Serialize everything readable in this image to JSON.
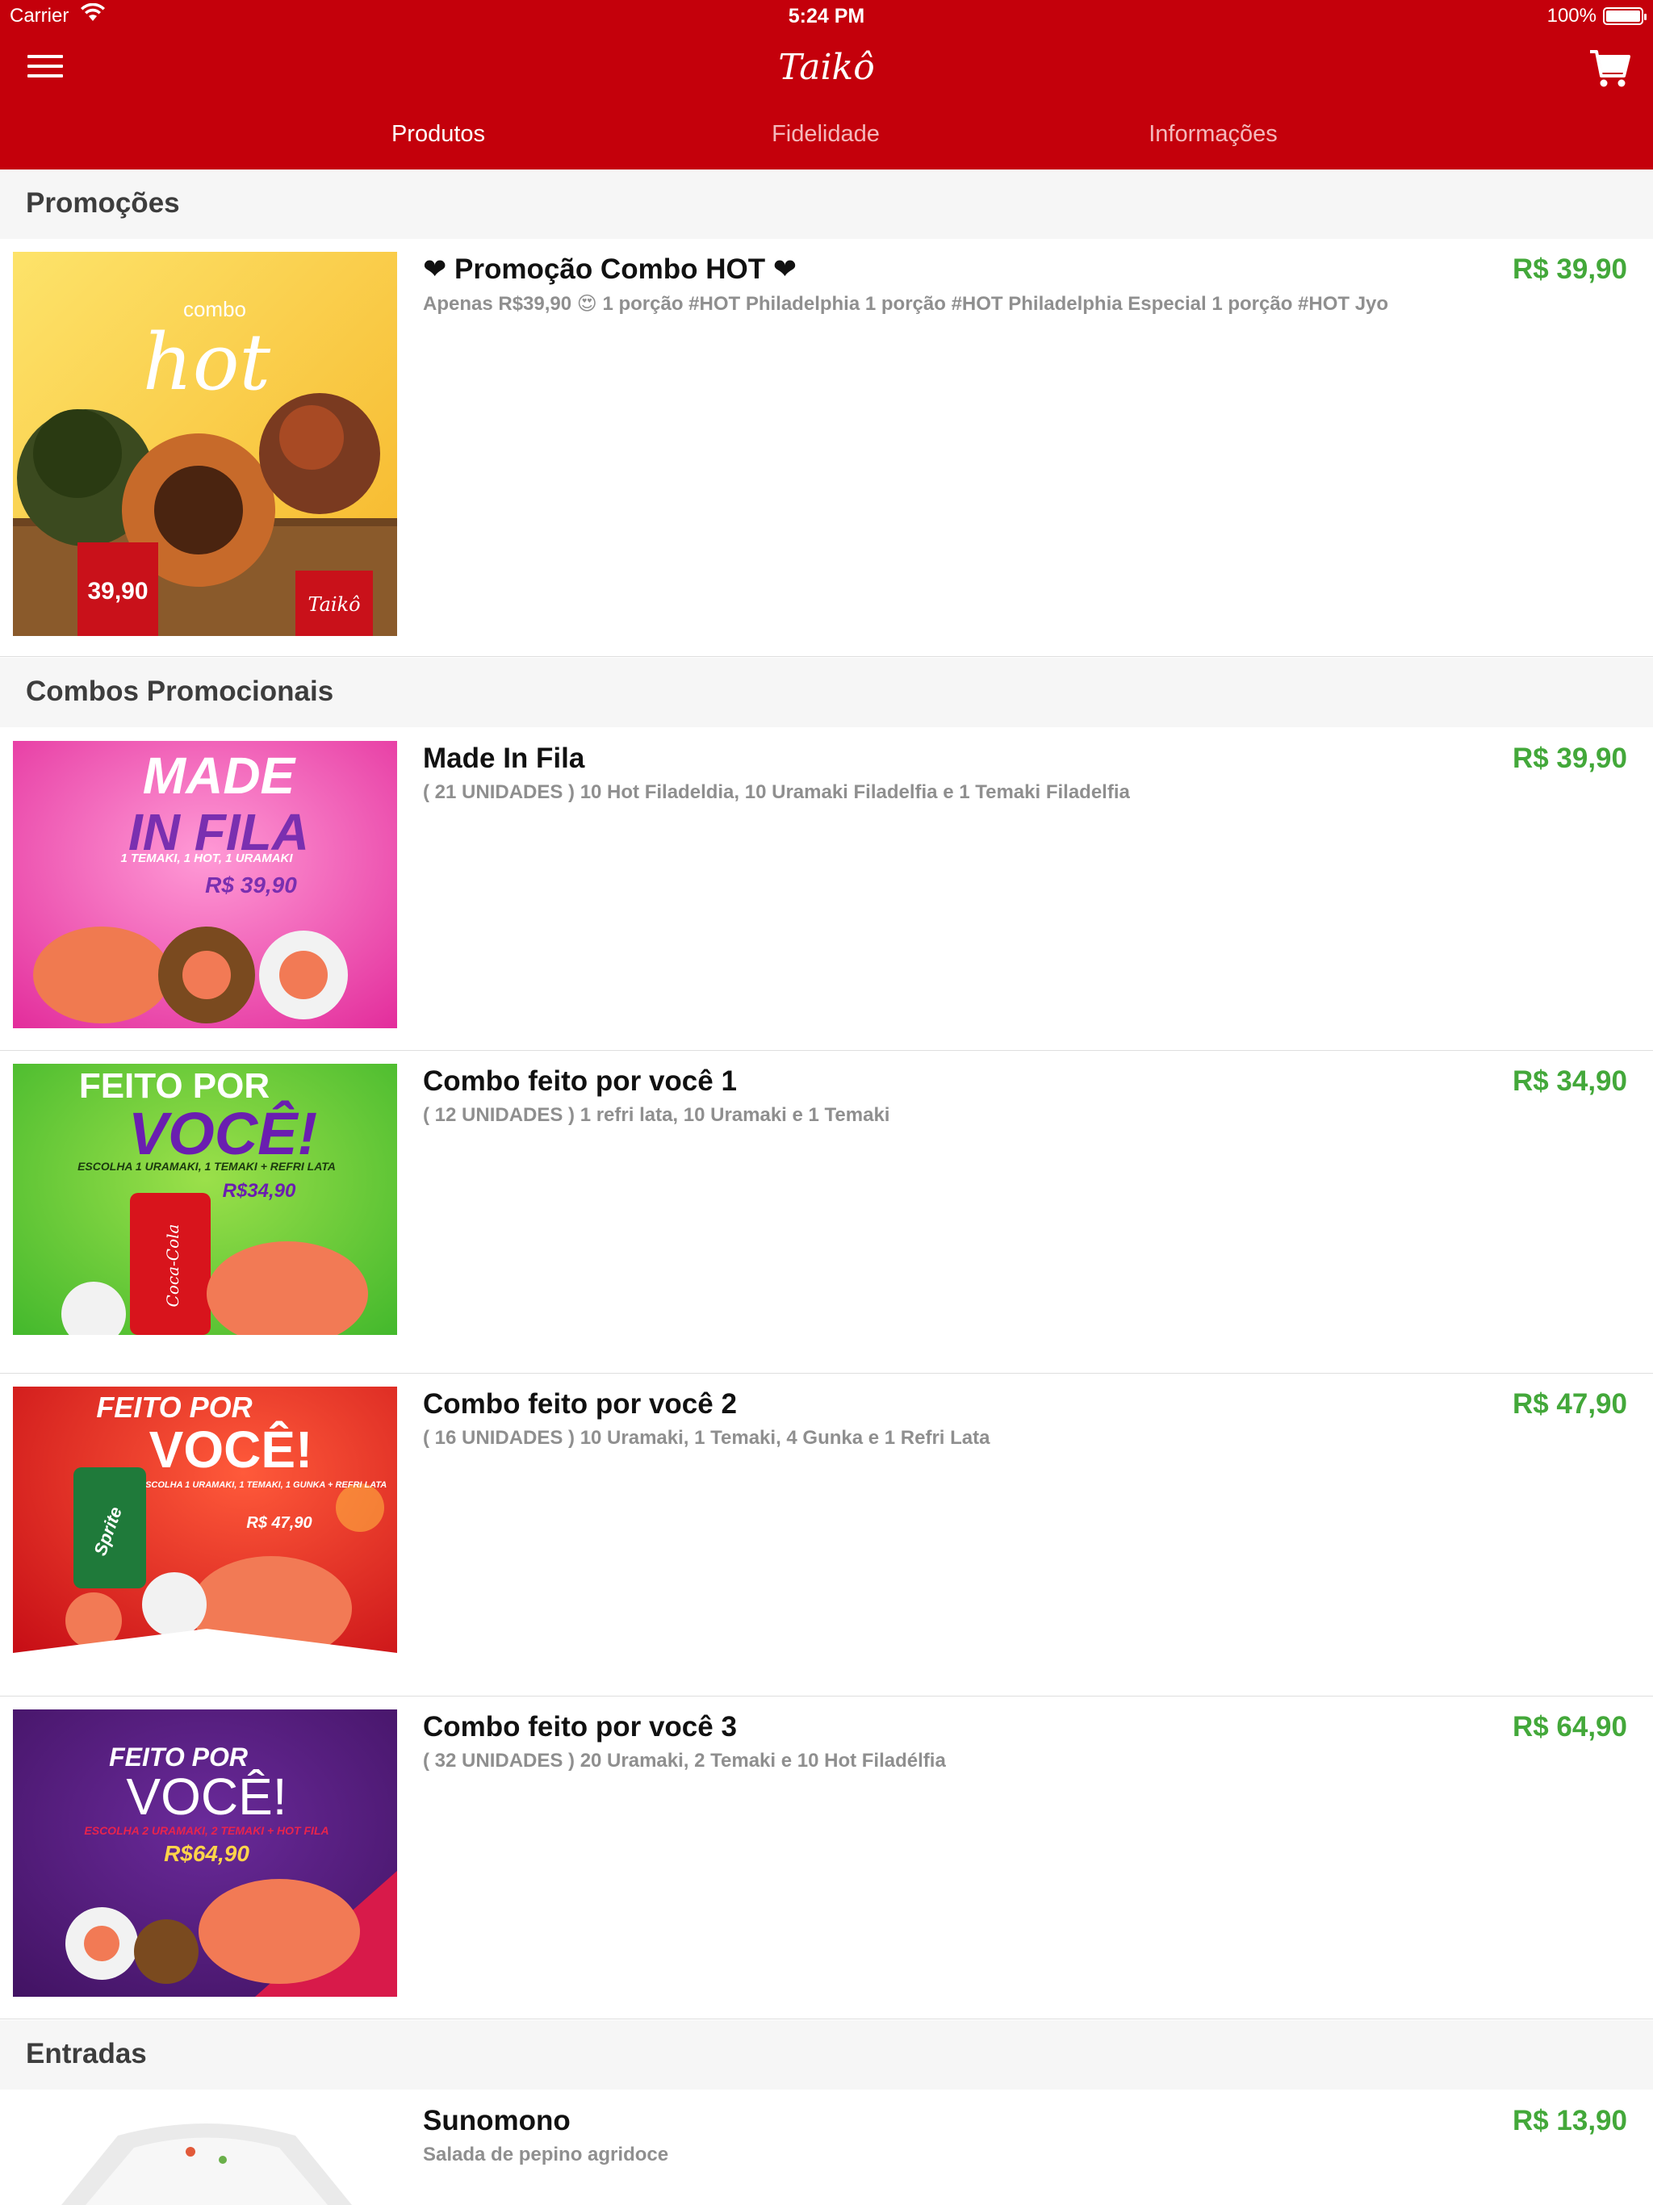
{
  "status_bar": {
    "carrier": "Carrier",
    "time": "5:24 PM",
    "battery": "100%"
  },
  "header": {
    "logo_text": "Taikô",
    "brand_color": "#c4000b"
  },
  "tabs": [
    {
      "label": "Produtos",
      "active": true
    },
    {
      "label": "Fidelidade",
      "active": false
    },
    {
      "label": "Informações",
      "active": false
    }
  ],
  "sections": [
    {
      "title": "Promoções",
      "items": [
        {
          "title": "❤ Promoção Combo HOT ❤",
          "description": "Apenas R$39,90 😍 1 porção #HOT Philadelphia 1 porção #HOT Philadelphia Especial 1 porção #HOT Jyo",
          "price": "R$ 39,90",
          "image_text": {
            "line1": "combo",
            "line2": "hot",
            "price": "39,90",
            "brand": "Taikô"
          }
        }
      ]
    },
    {
      "title": "Combos Promocionais",
      "items": [
        {
          "title": "Made In Fila",
          "description": "( 21 UNIDADES ) 10 Hot Filadeldia, 10 Uramaki Filadelfia e 1 Temaki Filadelfia",
          "price": "R$ 39,90",
          "image_text": {
            "line1": "MADE",
            "line2": "IN FILA",
            "sub": "1 TEMAKI, 1 HOT, 1 URAMAKI",
            "price": "R$ 39,90"
          }
        },
        {
          "title": "Combo feito por você 1",
          "description": "( 12 UNIDADES ) 1 refri lata, 10 Uramaki e 1 Temaki",
          "price": "R$ 34,90",
          "image_text": {
            "line1": "FEITO POR",
            "line2": "VOCÊ!",
            "sub": "ESCOLHA 1 URAMAKI, 1 TEMAKI + REFRI LATA",
            "price": "R$34,90",
            "can": "Coca-Cola"
          }
        },
        {
          "title": "Combo feito por você 2",
          "description": "( 16 UNIDADES ) 10 Uramaki, 1 Temaki, 4 Gunka e 1 Refri Lata",
          "price": "R$ 47,90",
          "image_text": {
            "line1": "FEITO POR",
            "line2": "VOCÊ!",
            "sub": "ESCOLHA 1 URAMAKI, 1 TEMAKI, 1 GUNKA + REFRI LATA",
            "price": "R$ 47,90",
            "can": "Sprite"
          }
        },
        {
          "title": "Combo feito por você 3",
          "description": "( 32 UNIDADES ) 20 Uramaki, 2 Temaki e 10 Hot Filadélfia",
          "price": "R$ 64,90",
          "image_text": {
            "line1": "FEITO POR",
            "line2": "VOCÊ!",
            "sub": "ESCOLHA 2 URAMAKI, 2 TEMAKI + HOT FILA",
            "price": "R$64,90"
          }
        }
      ]
    },
    {
      "title": "Entradas",
      "items": [
        {
          "title": "Sunomono",
          "description": "Salada de pepino agridoce",
          "price": "R$ 13,90"
        }
      ]
    }
  ],
  "colors": {
    "price": "#43a83a",
    "section_bg": "#f6f6f6"
  }
}
